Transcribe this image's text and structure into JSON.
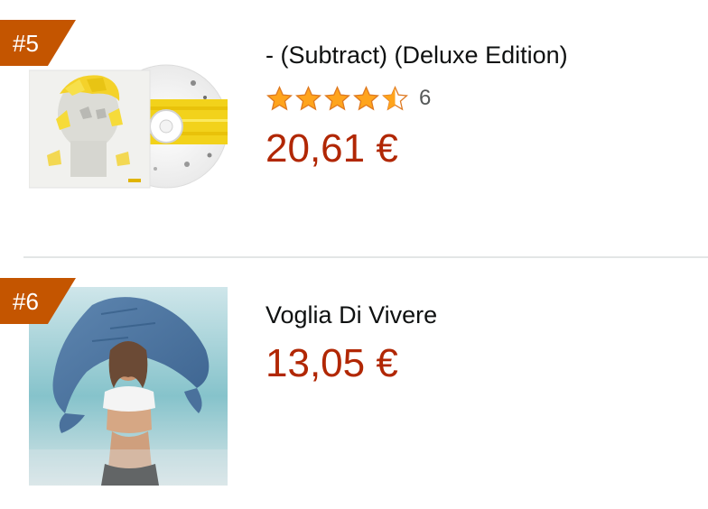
{
  "items": [
    {
      "rank": "#5",
      "title": "- (Subtract) (Deluxe Edition)",
      "rating": 4.5,
      "rating_count": "6",
      "price": "20,61 €",
      "image_icon": "album-cover-with-cd"
    },
    {
      "rank": "#6",
      "title": "Voglia Di Vivere",
      "price": "13,05 €",
      "image_icon": "album-cover-photo"
    }
  ],
  "colors": {
    "badge": "#c45500",
    "price": "#b12704",
    "star": "#ffa41c",
    "divider": "#e3e6e6"
  }
}
